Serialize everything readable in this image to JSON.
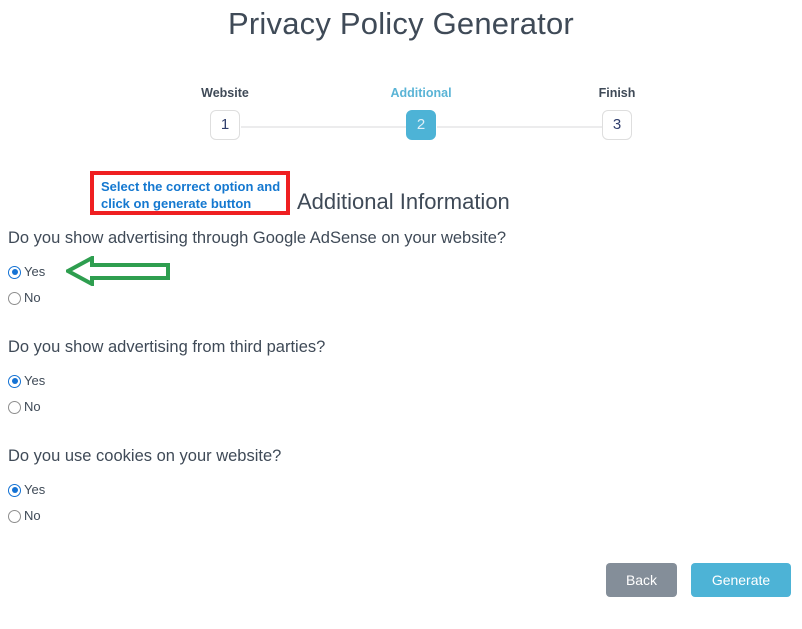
{
  "page": {
    "title": "Privacy Policy Generator"
  },
  "stepper": {
    "steps": [
      {
        "label": "Website",
        "number": "1",
        "active": false
      },
      {
        "label": "Additional",
        "number": "2",
        "active": true
      },
      {
        "label": "Finish",
        "number": "3",
        "active": false
      }
    ],
    "active_color": "#4db3d6",
    "inactive_label_color": "#3f4a57"
  },
  "annotation": {
    "text": "Select the correct option and click on generate button",
    "border_color": "#ef1f21",
    "text_color": "#1478d0",
    "arrow_color": "#2e9e4f",
    "arrow_direction": "left"
  },
  "section": {
    "heading": "Additional Information"
  },
  "questions": [
    {
      "text": "Do you show advertising through Google AdSense on your website?",
      "options": [
        {
          "label": "Yes",
          "selected": true
        },
        {
          "label": "No",
          "selected": false
        }
      ]
    },
    {
      "text": "Do you show advertising from third parties?",
      "options": [
        {
          "label": "Yes",
          "selected": true
        },
        {
          "label": "No",
          "selected": false
        }
      ]
    },
    {
      "text": "Do you use cookies on your website?",
      "options": [
        {
          "label": "Yes",
          "selected": true
        },
        {
          "label": "No",
          "selected": false
        }
      ]
    }
  ],
  "footer": {
    "back_label": "Back",
    "generate_label": "Generate",
    "back_color": "#848e99",
    "generate_color": "#4db3d6"
  }
}
